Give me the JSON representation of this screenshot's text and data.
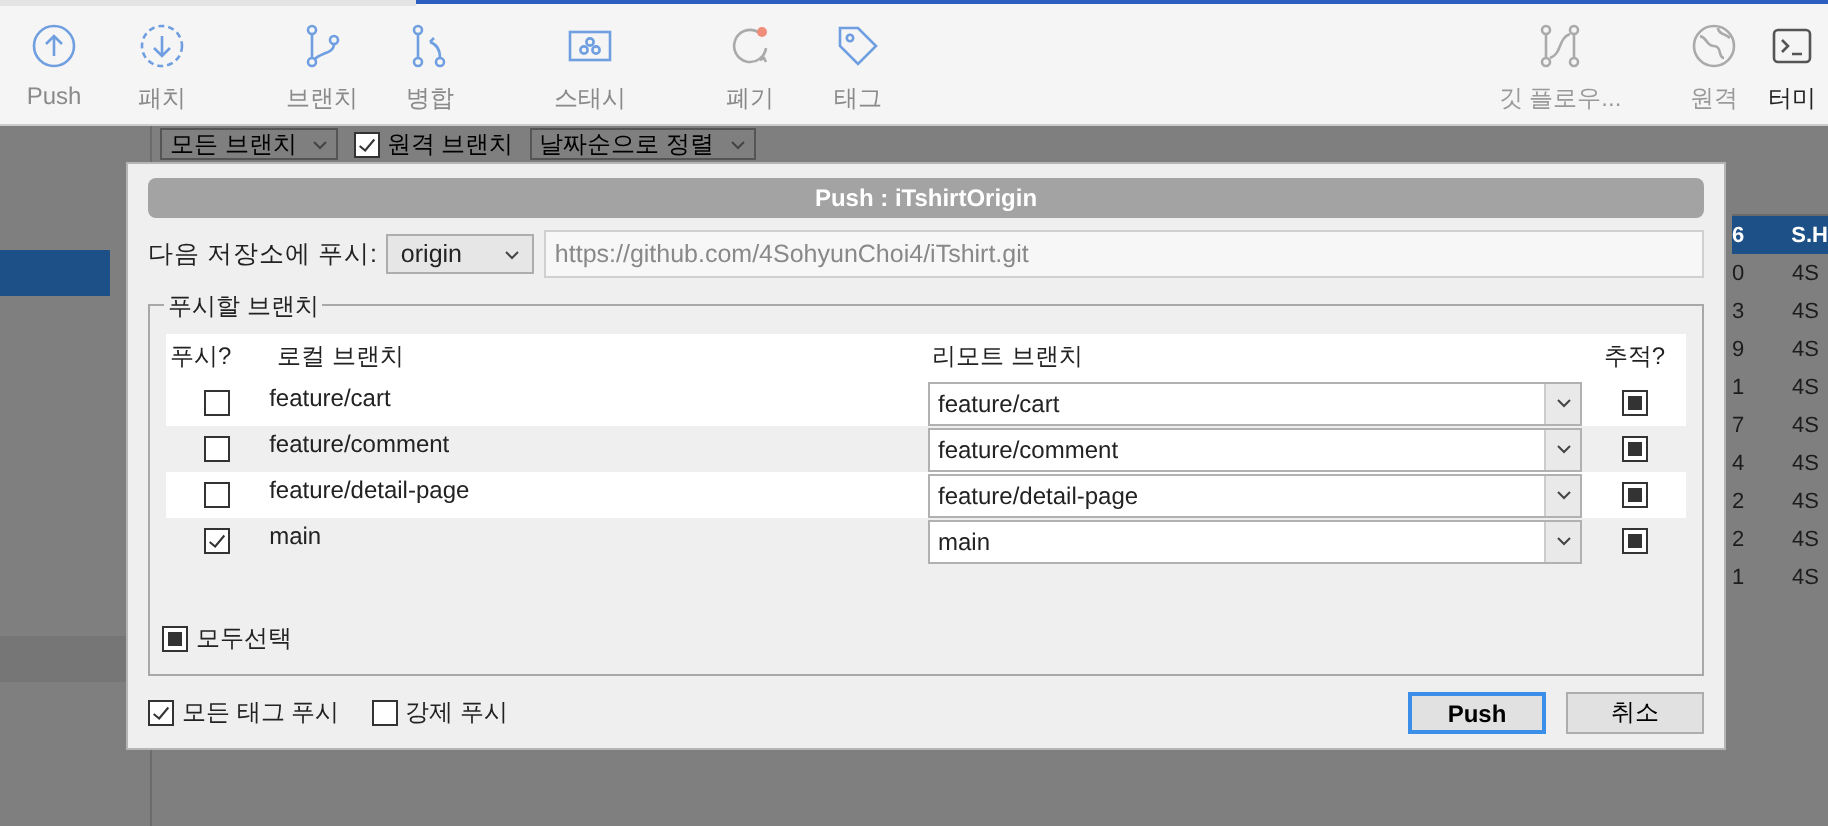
{
  "toolbar": {
    "left_groups": [
      [
        {
          "label": "Push"
        },
        {
          "label": "패치"
        }
      ],
      [
        {
          "label": "브랜치"
        },
        {
          "label": "병합"
        }
      ],
      [
        {
          "label": "스태시"
        }
      ],
      [
        {
          "label": "폐기"
        },
        {
          "label": "태그"
        }
      ]
    ],
    "right_items": [
      {
        "label": "깃 플로우...",
        "disabled": true
      },
      {
        "label": "원격",
        "disabled": true
      },
      {
        "label": "터미",
        "disabled": false
      }
    ]
  },
  "sidebar": {
    "items": [
      {
        "selected": true
      },
      {
        "selected": false
      }
    ]
  },
  "filter_bar": {
    "branch_filter": "모든 브랜치",
    "remote_branches": {
      "label": "원격 브랜치",
      "checked": true
    },
    "sort": "날짜순으로 정렬"
  },
  "commit_table": {
    "rows": [
      {
        "column_1": "6",
        "column_2": "S.H",
        "selected": true
      },
      {
        "column_1": "0",
        "column_2": "4S",
        "selected": false
      },
      {
        "column_1": "3",
        "column_2": "4S",
        "selected": false
      },
      {
        "column_1": "9",
        "column_2": "4S",
        "selected": false
      },
      {
        "column_1": "1",
        "column_2": "4S",
        "selected": false
      },
      {
        "column_1": "7",
        "column_2": "4S",
        "selected": false
      },
      {
        "column_1": "4",
        "column_2": "4S",
        "selected": false
      },
      {
        "column_1": "2",
        "column_2": "4S",
        "selected": false
      },
      {
        "column_1": "2",
        "column_2": "4S",
        "selected": false
      },
      {
        "column_1": "1",
        "column_2": "4S",
        "selected": false
      }
    ]
  },
  "dialog": {
    "title": "Push :  iTshirtOrigin",
    "remote_label": "다음 저장소에 푸시:",
    "remote": "origin",
    "remote_url": "https://github.com/4SohyunChoi4/iTshirt.git",
    "group_title": "푸시할 브랜치",
    "columns": [
      "푸시?",
      "로컬 브랜치",
      "리모트 브랜치",
      "추적?"
    ],
    "branches": [
      {
        "push": false,
        "local": "feature/cart",
        "remote": "feature/cart",
        "track": true
      },
      {
        "push": false,
        "local": "feature/comment",
        "remote": "feature/comment",
        "track": true
      },
      {
        "push": false,
        "local": "feature/detail-page",
        "remote": "feature/detail-page",
        "track": true
      },
      {
        "push": true,
        "local": "main",
        "remote": "main",
        "track": true
      }
    ],
    "select_all": {
      "label": "모두선택",
      "checked": false,
      "indeterminate": true
    },
    "options": [
      {
        "label": "모든 태그 푸시",
        "checked": true
      },
      {
        "label": "강제 푸시",
        "checked": false
      }
    ],
    "buttons": [
      {
        "label": "Push",
        "default": true
      },
      {
        "label": "취소",
        "default": false
      }
    ]
  }
}
